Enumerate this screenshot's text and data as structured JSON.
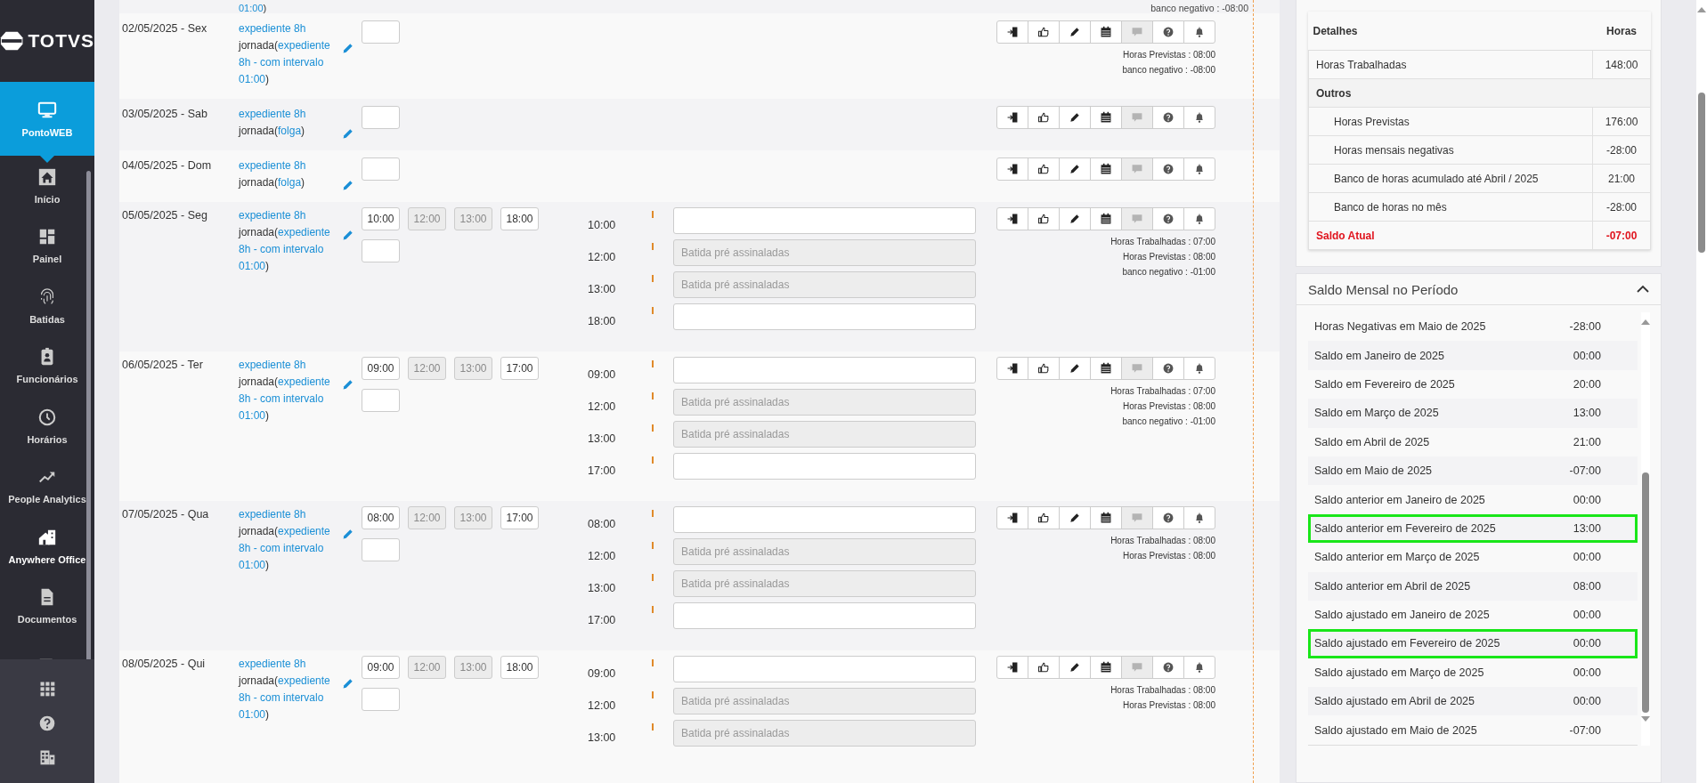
{
  "sidebar": {
    "logo": "TOTVS",
    "items": [
      {
        "kind": "monitor",
        "label": "PontoWEB",
        "selected": true,
        "emphasized": false
      },
      {
        "kind": "home",
        "label": "Início",
        "selected": false,
        "emphasized": false
      },
      {
        "kind": "dashboard",
        "label": "Painel",
        "selected": false,
        "emphasized": false
      },
      {
        "kind": "fingerprint",
        "label": "Batidas",
        "selected": false,
        "emphasized": false
      },
      {
        "kind": "badge",
        "label": "Funcionários",
        "selected": false,
        "emphasized": false
      },
      {
        "kind": "clock",
        "label": "Horários",
        "selected": false,
        "emphasized": false
      },
      {
        "kind": "trend",
        "label": "People Analytics",
        "selected": false,
        "emphasized": false
      },
      {
        "kind": "office",
        "label": "Anywhere Office",
        "selected": false,
        "emphasized": true
      },
      {
        "kind": "document",
        "label": "Documentos",
        "selected": false,
        "emphasized": false
      },
      {
        "kind": "calculator",
        "selected": false,
        "emphasized": false
      }
    ],
    "bottom": [
      {
        "kind": "apps"
      },
      {
        "kind": "help"
      },
      {
        "kind": "building"
      }
    ]
  },
  "actions": [
    {
      "kind": "enter",
      "disabled": false
    },
    {
      "kind": "thumb",
      "disabled": false
    },
    {
      "kind": "pencil",
      "disabled": false
    },
    {
      "kind": "calendar",
      "disabled": false
    },
    {
      "kind": "chat",
      "disabled": true
    },
    {
      "kind": "help",
      "disabled": false
    },
    {
      "kind": "bell",
      "disabled": false
    }
  ],
  "previous_day_tail": {
    "jornada_value": "01:00",
    "jornada_suffix": ")",
    "summary": "banco negativo : -08:00"
  },
  "days": [
    {
      "date": "02/05/2025 - Sex",
      "schedule": "expediente 8h",
      "jornada_prefix": "jornada(",
      "jornada_value": "expediente 8h - com intervalo 01:00",
      "jornada_suffix": ")",
      "new_field": true,
      "summary": [
        "Horas Previstas : 08:00",
        "banco negativo : -08:00"
      ]
    },
    {
      "date": "03/05/2025 - Sab",
      "schedule": "expediente 8h",
      "jornada_prefix": "jornada(",
      "jornada_value": "folga",
      "jornada_suffix": ")",
      "new_field": true
    },
    {
      "date": "04/05/2025 - Dom",
      "schedule": "expediente 8h",
      "jornada_prefix": "jornada(",
      "jornada_value": "folga",
      "jornada_suffix": ")",
      "new_field": true
    },
    {
      "date": "05/05/2025 - Seg",
      "schedule": "expediente 8h",
      "jornada_prefix": "jornada(",
      "jornada_value": "expediente 8h - com intervalo 01:00",
      "jornada_suffix": ")",
      "time_fields": [
        {
          "value": "10:00",
          "disabled": false
        },
        {
          "value": "12:00",
          "disabled": true
        },
        {
          "value": "13:00",
          "disabled": true
        },
        {
          "value": "18:00",
          "disabled": false
        }
      ],
      "new_field": true,
      "punches": [
        {
          "time": "10:00",
          "disabled": false
        },
        {
          "time": "12:00",
          "placeholder": "Batida pré assinaladas",
          "disabled": true
        },
        {
          "time": "13:00",
          "placeholder": "Batida pré assinaladas",
          "disabled": true
        },
        {
          "time": "18:00",
          "disabled": false
        }
      ],
      "summary": [
        "Horas Trabalhadas : 07:00",
        "Horas Previstas : 08:00",
        "banco negativo : -01:00"
      ]
    },
    {
      "date": "06/05/2025 - Ter",
      "schedule": "expediente 8h",
      "jornada_prefix": "jornada(",
      "jornada_value": "expediente 8h - com intervalo 01:00",
      "jornada_suffix": ")",
      "time_fields": [
        {
          "value": "09:00",
          "disabled": false
        },
        {
          "value": "12:00",
          "disabled": true
        },
        {
          "value": "13:00",
          "disabled": true
        },
        {
          "value": "17:00",
          "disabled": false
        }
      ],
      "new_field": true,
      "punches": [
        {
          "time": "09:00",
          "disabled": false
        },
        {
          "time": "12:00",
          "placeholder": "Batida pré assinaladas",
          "disabled": true
        },
        {
          "time": "13:00",
          "placeholder": "Batida pré assinaladas",
          "disabled": true
        },
        {
          "time": "17:00",
          "disabled": false
        }
      ],
      "summary": [
        "Horas Trabalhadas : 07:00",
        "Horas Previstas : 08:00",
        "banco negativo : -01:00"
      ]
    },
    {
      "date": "07/05/2025 - Qua",
      "schedule": "expediente 8h",
      "jornada_prefix": "jornada(",
      "jornada_value": "expediente 8h - com intervalo 01:00",
      "jornada_suffix": ")",
      "time_fields": [
        {
          "value": "08:00",
          "disabled": false
        },
        {
          "value": "12:00",
          "disabled": true
        },
        {
          "value": "13:00",
          "disabled": true
        },
        {
          "value": "17:00",
          "disabled": false
        }
      ],
      "new_field": true,
      "punches": [
        {
          "time": "08:00",
          "disabled": false
        },
        {
          "time": "12:00",
          "placeholder": "Batida pré assinaladas",
          "disabled": true
        },
        {
          "time": "13:00",
          "placeholder": "Batida pré assinaladas",
          "disabled": true
        },
        {
          "time": "17:00",
          "disabled": false
        }
      ],
      "summary": [
        "Horas Trabalhadas : 08:00",
        "Horas Previstas : 08:00"
      ]
    },
    {
      "date": "08/05/2025 - Qui",
      "schedule": "expediente 8h",
      "jornada_prefix": "jornada(",
      "jornada_value": "expediente 8h - com intervalo 01:00",
      "jornada_suffix": ")",
      "time_fields": [
        {
          "value": "09:00",
          "disabled": false
        },
        {
          "value": "12:00",
          "disabled": true
        },
        {
          "value": "13:00",
          "disabled": true
        },
        {
          "value": "18:00",
          "disabled": false
        }
      ],
      "new_field": true,
      "punches": [
        {
          "time": "09:00",
          "disabled": false
        },
        {
          "time": "12:00",
          "placeholder": "Batida pré assinaladas",
          "disabled": true
        },
        {
          "time": "13:00",
          "placeholder": "Batida pré assinaladas",
          "disabled": true
        }
      ],
      "summary": [
        "Horas Trabalhadas : 08:00",
        "Horas Previstas : 08:00"
      ]
    }
  ],
  "details": {
    "columns": [
      "Detalhes",
      "Horas"
    ],
    "rows": [
      {
        "kind": "item",
        "label": "Horas Trabalhadas",
        "value": "148:00"
      },
      {
        "kind": "group",
        "label": "Outros"
      },
      {
        "kind": "subitem",
        "label": "Horas Previstas",
        "value": "176:00"
      },
      {
        "kind": "subitem",
        "label": "Horas mensais negativas",
        "value": "-28:00"
      },
      {
        "kind": "subitem",
        "label": "Banco de horas acumulado até Abril / 2025",
        "value": "21:00"
      },
      {
        "kind": "subitem",
        "label": "Banco de horas no mês",
        "value": "-28:00"
      },
      {
        "kind": "total",
        "label": "Saldo Atual",
        "value": "-07:00"
      }
    ]
  },
  "monthly": {
    "title": "Saldo Mensal no Período",
    "expanded": true,
    "items": [
      {
        "label": "Horas Negativas em Maio de 2025",
        "value": "-28:00",
        "highlighted": false
      },
      {
        "label": "Saldo em Janeiro de 2025",
        "value": "00:00",
        "highlighted": false
      },
      {
        "label": "Saldo em Fevereiro de 2025",
        "value": "20:00",
        "highlighted": false
      },
      {
        "label": "Saldo em Março de 2025",
        "value": "13:00",
        "highlighted": false
      },
      {
        "label": "Saldo em Abril de 2025",
        "value": "21:00",
        "highlighted": false
      },
      {
        "label": "Saldo em Maio de 2025",
        "value": "-07:00",
        "highlighted": false
      },
      {
        "label": "Saldo anterior em Janeiro de 2025",
        "value": "00:00",
        "highlighted": false
      },
      {
        "label": "Saldo anterior em Fevereiro de 2025",
        "value": "13:00",
        "highlighted": true
      },
      {
        "label": "Saldo anterior em Março de 2025",
        "value": "00:00",
        "highlighted": false
      },
      {
        "label": "Saldo anterior em Abril de 2025",
        "value": "08:00",
        "highlighted": false
      },
      {
        "label": "Saldo ajustado em Janeiro de 2025",
        "value": "00:00",
        "highlighted": false
      },
      {
        "label": "Saldo ajustado em Fevereiro de 2025",
        "value": "00:00",
        "highlighted": true
      },
      {
        "label": "Saldo ajustado em Março de 2025",
        "value": "00:00",
        "highlighted": false
      },
      {
        "label": "Saldo ajustado em Abril de 2025",
        "value": "00:00",
        "highlighted": false
      },
      {
        "label": "Saldo ajustado em Maio de 2025",
        "value": "-07:00",
        "highlighted": false
      }
    ]
  }
}
